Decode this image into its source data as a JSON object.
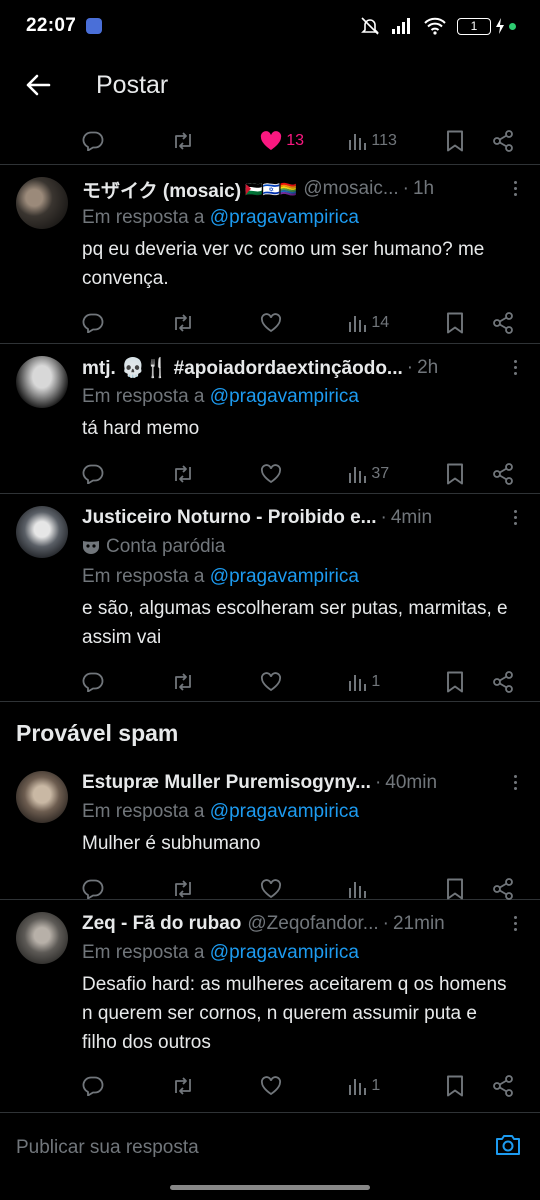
{
  "status": {
    "time": "22:07",
    "battery": "1"
  },
  "header": {
    "title": "Postar"
  },
  "top_actions": {
    "likes": "13",
    "views": "113"
  },
  "tweets": [
    {
      "name": "モザイク (mosaic)",
      "emojis": "🇵🇸🇮🇱🏳️‍🌈",
      "handle": "@mosaic...",
      "time": "1h",
      "reply_prefix": "Em resposta a",
      "reply_to": "@pragavampirica",
      "text": "pq eu deveria ver vc como um ser humano? me convença.",
      "views": "14"
    },
    {
      "name": "mtj. 💀🍴 #apoiadordaextinçãodo...",
      "time": "2h",
      "reply_prefix": "Em resposta a",
      "reply_to": "@pragavampirica",
      "text": "tá hard memo",
      "views": "37"
    },
    {
      "name": "Justiceiro Noturno - Proibido e...",
      "time": "4min",
      "parody": "Conta paródia",
      "reply_prefix": "Em resposta a",
      "reply_to": "@pragavampirica",
      "text": "e são, algumas escolheram ser putas, marmitas, e assim vai",
      "views": "1"
    }
  ],
  "spam_section": {
    "title": "Provável spam"
  },
  "spam_tweets": [
    {
      "name": "Estupræ Muller Puremisogyny...",
      "time": "40min",
      "reply_prefix": "Em resposta a",
      "reply_to": "@pragavampirica",
      "text": "Mulher é subhumano",
      "views": ""
    },
    {
      "name": "Zeq - Fã do rubao",
      "handle": "@Zeqofandor...",
      "time": "21min",
      "reply_prefix": "Em resposta a",
      "reply_to": "@pragavampirica",
      "text": "Desafio hard: as mulheres aceitarem q os homens n querem ser cornos, n querem assumir puta e filho dos outros",
      "views": "1"
    }
  ],
  "composer": {
    "placeholder": "Publicar sua resposta"
  },
  "colors": {
    "accent": "#1d9bf0",
    "like": "#f91880",
    "muted": "#71767b"
  }
}
